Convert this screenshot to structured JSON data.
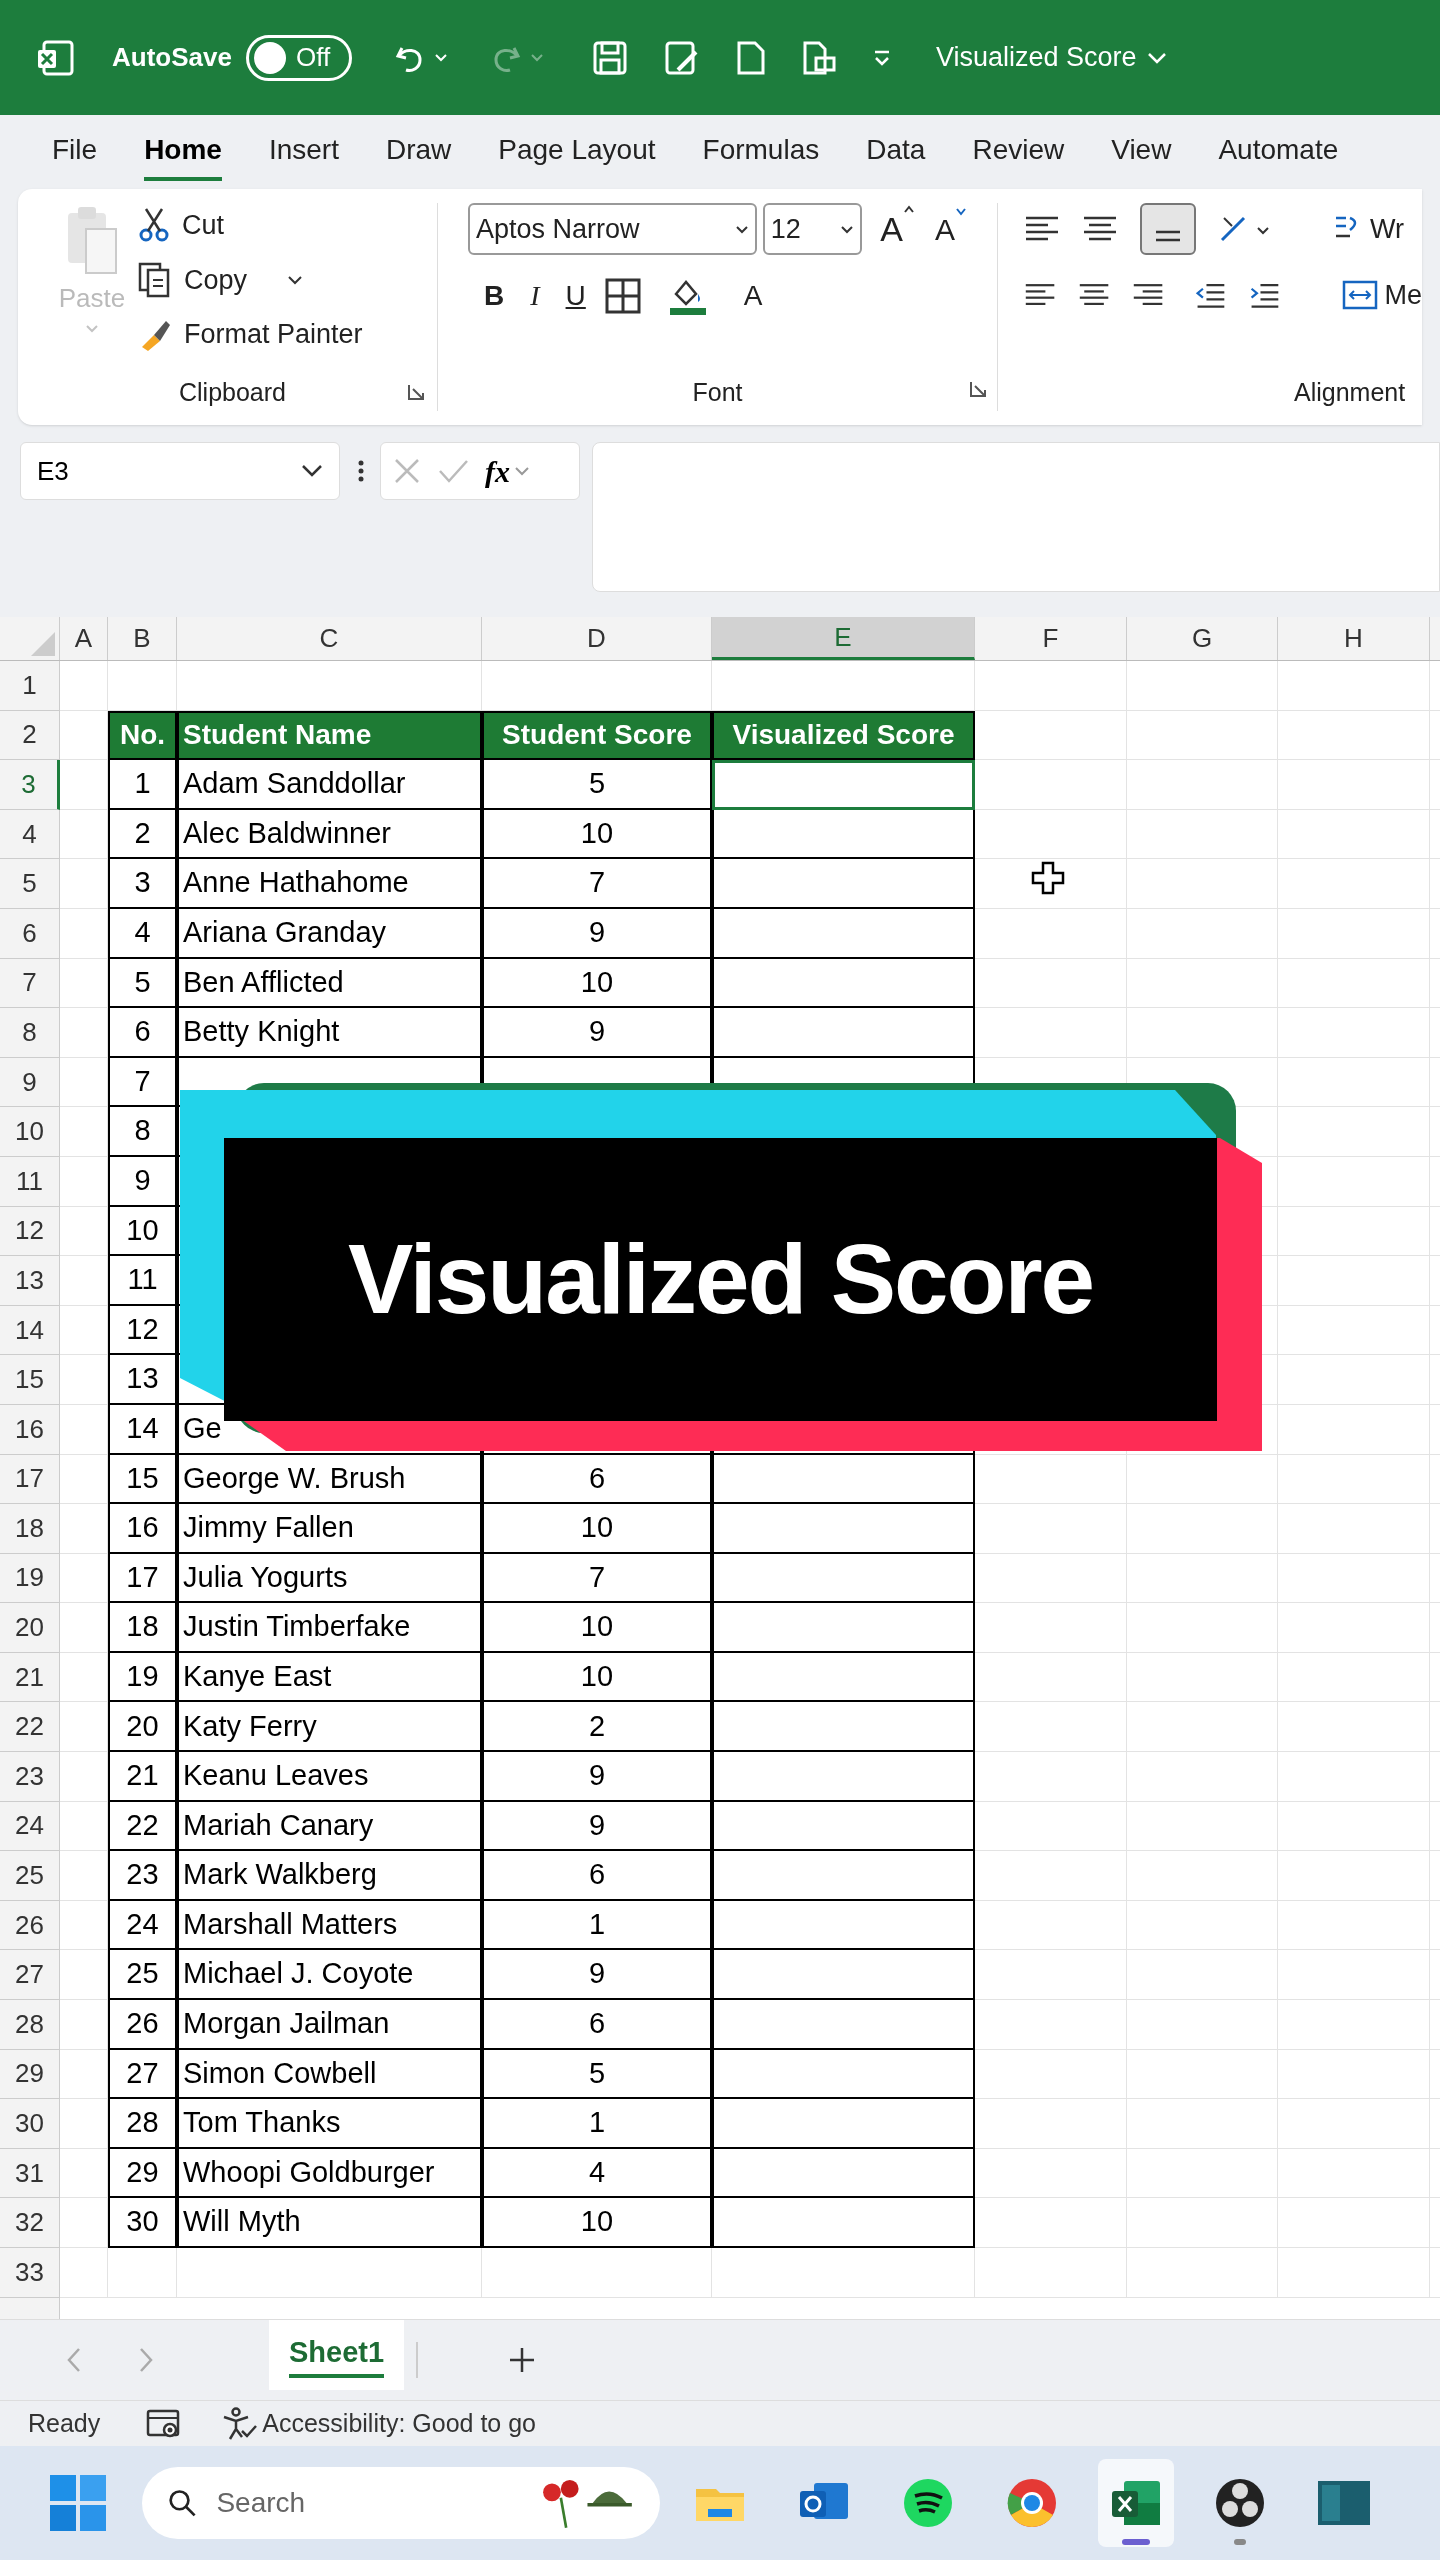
{
  "title_bar": {
    "autosave_label": "AutoSave",
    "autosave_on": false,
    "autosave_state": "Off",
    "document_title": "Visualized Score"
  },
  "ribbon_tabs": [
    {
      "label": "File",
      "selected": false
    },
    {
      "label": "Home",
      "selected": true
    },
    {
      "label": "Insert",
      "selected": false
    },
    {
      "label": "Draw",
      "selected": false
    },
    {
      "label": "Page Layout",
      "selected": false
    },
    {
      "label": "Formulas",
      "selected": false
    },
    {
      "label": "Data",
      "selected": false
    },
    {
      "label": "Review",
      "selected": false
    },
    {
      "label": "View",
      "selected": false
    },
    {
      "label": "Automate",
      "selected": false
    }
  ],
  "clipboard": {
    "paste": "Paste",
    "paste_disabled": true,
    "cut": "Cut",
    "copy": "Copy",
    "format_painter": "Format Painter",
    "group_label": "Clipboard"
  },
  "font": {
    "font_name": "Aptos Narrow",
    "font_size": "12",
    "grow_font": "A",
    "shrink_font": "A",
    "bold": "B",
    "italic": "I",
    "underline": "U",
    "font_color": "A",
    "group_label": "Font"
  },
  "alignment": {
    "wrap_text": "Wr",
    "merge": "Me",
    "group_label": "Alignment"
  },
  "formula_bar": {
    "name_box": "E3",
    "fx_label": "fx"
  },
  "columns": [
    {
      "label": "A",
      "selected": false
    },
    {
      "label": "B",
      "selected": false
    },
    {
      "label": "C",
      "selected": false
    },
    {
      "label": "D",
      "selected": false
    },
    {
      "label": "E",
      "selected": true
    },
    {
      "label": "F",
      "selected": false
    },
    {
      "label": "G",
      "selected": false
    },
    {
      "label": "H",
      "selected": false
    }
  ],
  "row_headers": [
    {
      "label": "1",
      "selected": false
    },
    {
      "label": "2",
      "selected": false
    },
    {
      "label": "3",
      "selected": true
    },
    {
      "label": "4",
      "selected": false
    },
    {
      "label": "5",
      "selected": false
    },
    {
      "label": "6",
      "selected": false
    },
    {
      "label": "7",
      "selected": false
    },
    {
      "label": "8",
      "selected": false
    },
    {
      "label": "9",
      "selected": false
    },
    {
      "label": "10",
      "selected": false
    },
    {
      "label": "11",
      "selected": false
    },
    {
      "label": "12",
      "selected": false
    },
    {
      "label": "13",
      "selected": false
    },
    {
      "label": "14",
      "selected": false
    },
    {
      "label": "15",
      "selected": false
    },
    {
      "label": "16",
      "selected": false
    },
    {
      "label": "17",
      "selected": false
    },
    {
      "label": "18",
      "selected": false
    },
    {
      "label": "19",
      "selected": false
    },
    {
      "label": "20",
      "selected": false
    },
    {
      "label": "21",
      "selected": false
    },
    {
      "label": "22",
      "selected": false
    },
    {
      "label": "23",
      "selected": false
    },
    {
      "label": "24",
      "selected": false
    },
    {
      "label": "25",
      "selected": false
    },
    {
      "label": "26",
      "selected": false
    },
    {
      "label": "27",
      "selected": false
    },
    {
      "label": "28",
      "selected": false
    },
    {
      "label": "29",
      "selected": false
    },
    {
      "label": "30",
      "selected": false
    },
    {
      "label": "31",
      "selected": false
    },
    {
      "label": "32",
      "selected": false
    },
    {
      "label": "33",
      "selected": false
    }
  ],
  "table": {
    "columns": [
      "No.",
      "Student Name",
      "Student Score",
      "Visualized Score"
    ],
    "rows": [
      {
        "no": "1",
        "name": "Adam Sanddollar",
        "score": "5",
        "selected": true
      },
      {
        "no": "2",
        "name": "Alec Baldwinner",
        "score": "10",
        "selected": false
      },
      {
        "no": "3",
        "name": "Anne Hathahome",
        "score": "7",
        "selected": false
      },
      {
        "no": "4",
        "name": "Ariana Granday",
        "score": "9",
        "selected": false
      },
      {
        "no": "5",
        "name": "Ben Afflicted",
        "score": "10",
        "selected": false
      },
      {
        "no": "6",
        "name": "Betty Knight",
        "score": "9",
        "selected": false
      },
      {
        "no": "7"
      },
      {
        "no": "8"
      },
      {
        "no": "9"
      },
      {
        "no": "10"
      },
      {
        "no": "11"
      },
      {
        "no": "12"
      },
      {
        "no": "13"
      },
      {
        "no": "14",
        "name": "Ge"
      },
      {
        "no": "15",
        "name": "George W. Brush",
        "score": "6",
        "selected": false
      },
      {
        "no": "16",
        "name": "Jimmy Fallen",
        "score": "10",
        "selected": false
      },
      {
        "no": "17",
        "name": "Julia Yogurts",
        "score": "7",
        "selected": false
      },
      {
        "no": "18",
        "name": "Justin Timberfake",
        "score": "10",
        "selected": false
      },
      {
        "no": "19",
        "name": "Kanye East",
        "score": "10",
        "selected": false
      },
      {
        "no": "20",
        "name": "Katy Ferry",
        "score": "2",
        "selected": false
      },
      {
        "no": "21",
        "name": "Keanu Leaves",
        "score": "9",
        "selected": false
      },
      {
        "no": "22",
        "name": "Mariah Canary",
        "score": "9",
        "selected": false
      },
      {
        "no": "23",
        "name": "Mark Walkberg",
        "score": "6",
        "selected": false
      },
      {
        "no": "24",
        "name": "Marshall Matters",
        "score": "1",
        "selected": false
      },
      {
        "no": "25",
        "name": "Michael J. Coyote",
        "score": "9",
        "selected": false
      },
      {
        "no": "26",
        "name": "Morgan Jailman",
        "score": "6",
        "selected": false
      },
      {
        "no": "27",
        "name": "Simon Cowbell",
        "score": "5",
        "selected": false
      },
      {
        "no": "28",
        "name": "Tom Thanks",
        "score": "1",
        "selected": false
      },
      {
        "no": "29",
        "name": "Whoopi Goldburger",
        "score": "4",
        "selected": false
      },
      {
        "no": "30",
        "name": "Will Myth",
        "score": "10",
        "selected": false
      }
    ]
  },
  "overlay_title": "Visualized Score",
  "sheet_tabs": [
    {
      "label": "Sheet1",
      "selected": true
    }
  ],
  "status_bar": {
    "ready": "Ready",
    "accessibility": "Accessibility: Good to go"
  },
  "taskbar": {
    "search_placeholder": "Search",
    "apps": [
      {
        "kind": "explorer",
        "selected": false,
        "running": false
      },
      {
        "kind": "outlook",
        "selected": false,
        "running": false
      },
      {
        "kind": "spotify",
        "selected": false,
        "running": false
      },
      {
        "kind": "chrome",
        "selected": false,
        "running": false
      },
      {
        "kind": "excel",
        "selected": true,
        "running": true
      },
      {
        "kind": "obs",
        "selected": false,
        "running": true
      },
      {
        "kind": "panel",
        "selected": false,
        "running": false
      }
    ]
  }
}
